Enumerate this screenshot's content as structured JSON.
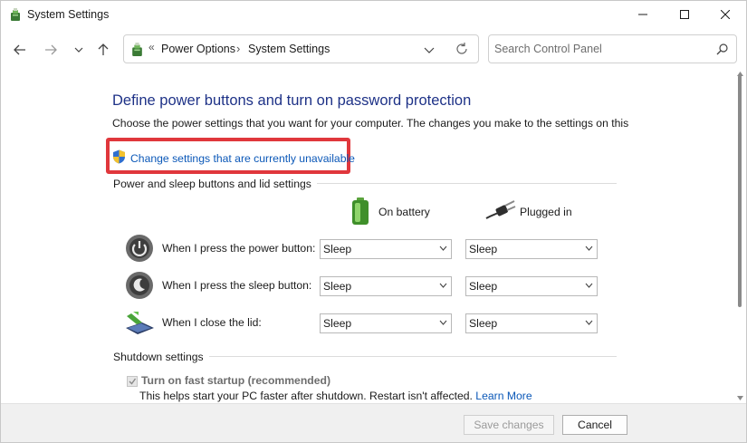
{
  "window": {
    "title": "System Settings",
    "minimize_icon": "minimize-icon",
    "maximize_icon": "maximize-icon",
    "close_icon": "close-icon"
  },
  "nav": {
    "breadcrumb_sep": "«",
    "crumbs": [
      "Power Options",
      "System Settings"
    ],
    "crumb_arrow": "›",
    "search_placeholder": "Search Control Panel"
  },
  "content": {
    "title": "Define power buttons and turn on password protection",
    "description": "Choose the power settings that you want for your computer. The changes you make to the settings on this",
    "change_link": "Change settings that are currently unavailable",
    "group1_label": "Power and sleep buttons and lid settings",
    "col_battery": "On battery",
    "col_plugged": "Plugged in",
    "rows": [
      {
        "label": "When I press the power button:",
        "battery": "Sleep",
        "plugged": "Sleep"
      },
      {
        "label": "When I press the sleep button:",
        "battery": "Sleep",
        "plugged": "Sleep"
      },
      {
        "label": "When I close the lid:",
        "battery": "Sleep",
        "plugged": "Sleep"
      }
    ],
    "group2_label": "Shutdown settings",
    "fast_startup_label": "Turn on fast startup (recommended)",
    "fast_startup_checked": true,
    "fast_startup_desc": "This helps start your PC faster after shutdown. Restart isn't affected.",
    "learn_more": "Learn More"
  },
  "footer": {
    "save_label": "Save changes",
    "cancel_label": "Cancel"
  },
  "colors": {
    "title_blue": "#1e3287",
    "link_blue": "#0b58b8",
    "highlight_red": "#e0373c"
  }
}
